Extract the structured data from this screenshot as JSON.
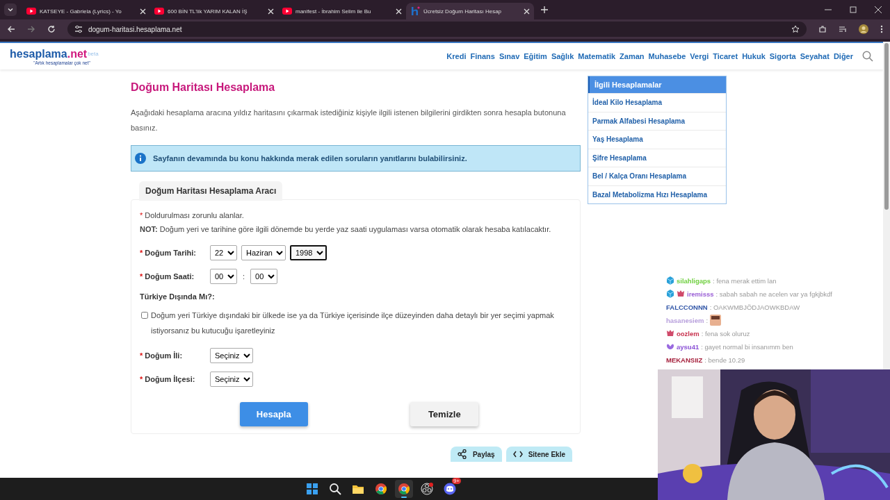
{
  "browser": {
    "tabs": [
      {
        "title": "KATSEYE - Gabriela (Lyrics) - Yo",
        "kind": "video",
        "selected": false
      },
      {
        "title": "600 BİN TL'lik YARIM KALAN İŞ",
        "kind": "video",
        "selected": false
      },
      {
        "title": "manifest - İbrahim Selim ile Bu",
        "kind": "video",
        "selected": false
      },
      {
        "title": "Ücretsiz Doğum Haritası Hesap",
        "kind": "site",
        "selected": true
      }
    ],
    "url": "dogum-haritasi.hesaplama.net"
  },
  "site": {
    "logo": {
      "name": "hesaplama",
      "tld": ".net",
      "badge": "beta",
      "slogan": "\"Artık hesaplamalar çok net\""
    },
    "nav": [
      "Kredi",
      "Finans",
      "Sınav",
      "Eğitim",
      "Sağlık",
      "Matematik",
      "Zaman",
      "Muhasebe",
      "Vergi",
      "Ticaret",
      "Hukuk",
      "Sigorta",
      "Seyahat",
      "Diğer"
    ]
  },
  "page": {
    "title": "Doğum Haritası Hesaplama",
    "intro": "Aşağıdaki hesaplama aracına yıldız haritasını çıkarmak istediğiniz kişiyle ilgili istenen bilgilerini girdikten sonra hesapla butonuna basınız.",
    "info": "Sayfanın devamında bu konu hakkında merak edilen soruların yanıtlarını bulabilirsiniz.",
    "tool": {
      "title": "Doğum Haritası Hesaplama Aracı",
      "required_note": {
        "mark": "*",
        "text": "Doldurulması zorunlu alanlar."
      },
      "note": "**NOT:** Doğum yeri ve tarihine göre ilgili dönemde bu yerde yaz saati uygulaması varsa otomatik olarak hesaba katılacaktır.",
      "fields": [
        {
          "mark": "*",
          "label": "Doğum Tarihi:",
          "selects": [
            {
              "value": "22",
              "focused": false
            },
            {
              "value": "Haziran",
              "focused": false
            },
            {
              "value": "1998",
              "focused": true
            }
          ]
        },
        {
          "mark": "*",
          "label": "Doğum Saati:",
          "separator": ":",
          "selects": [
            {
              "value": "00",
              "focused": false
            },
            {
              "value": "00",
              "focused": false
            }
          ]
        }
      ],
      "abroad": {
        "heading": "Türkiye Dışında Mı?:",
        "checked": false,
        "label": "Doğum yeri Türkiye dışındaki bir ülkede ise ya da Türkiye içerisinde ilçe düzeyinden daha detaylı bir yer seçimi yapmak istiyorsanız bu kutucuğu işaretleyiniz"
      },
      "place_fields": [
        {
          "mark": "*",
          "label": "Doğum İli:",
          "selects": [
            {
              "value": "Seçiniz",
              "focused": false
            }
          ]
        },
        {
          "mark": "*",
          "label": "Doğum İlçesi:",
          "selects": [
            {
              "value": "Seçiniz",
              "focused": false
            }
          ]
        }
      ],
      "buttons": [
        {
          "label": "Hesapla",
          "kind": "primary"
        },
        {
          "label": "Temizle",
          "kind": "secondary"
        }
      ]
    },
    "share": [
      {
        "label": "Paylaş",
        "kind": "share"
      },
      {
        "label": "Sitene Ekle",
        "kind": "embed"
      }
    ]
  },
  "sidebar": {
    "title": "İlgili Hesaplamalar",
    "items": [
      "İdeal Kilo Hesaplama",
      "Parmak Alfabesi Hesaplama",
      "Yaş Hesaplama",
      "Şifre Hesaplama",
      "Bel / Kalça Oranı Hesaplama",
      "Bazal Metabolizma Hızı Hesaplama"
    ]
  },
  "chat": [
    {
      "user": "silahligaps",
      "color": "#6fcf3f",
      "kind": "cube",
      "text": ": fena merak ettim lan"
    },
    {
      "user": "iremisss",
      "color": "#9a5fd6",
      "kind": "cubecrown",
      "text": ": sabah sabah ne acelen var ya fgkjbkdf"
    },
    {
      "user": "FALCCONNN",
      "color": "#2f54a6",
      "kind": "plain",
      "text": ": OAKWMBJÖDJAOWKBDAW"
    },
    {
      "user": "hasanesiem",
      "color": "#b79fdc",
      "kind": "plain",
      "text": ":",
      "emote": true
    },
    {
      "user": "oozlem",
      "color": "#c8324e",
      "kind": "crown",
      "text": ": fena sok oluruz"
    },
    {
      "user": "aysu41",
      "color": "#8b52d6",
      "kind": "wing",
      "text": ": gayet normal bi insanımm ben"
    },
    {
      "user": "MEKANSIIZ",
      "color": "#a5203c",
      "kind": "plain",
      "text": ": bende 10.29"
    }
  ],
  "taskbar": {
    "apps": [
      {
        "kind": "windows",
        "active": false
      },
      {
        "kind": "search",
        "active": false
      },
      {
        "kind": "folder",
        "active": false
      },
      {
        "kind": "chrome",
        "active": false
      },
      {
        "kind": "chrome",
        "active": true
      },
      {
        "kind": "obs",
        "active": false
      },
      {
        "kind": "discord",
        "active": false,
        "badge": "9+"
      }
    ]
  }
}
